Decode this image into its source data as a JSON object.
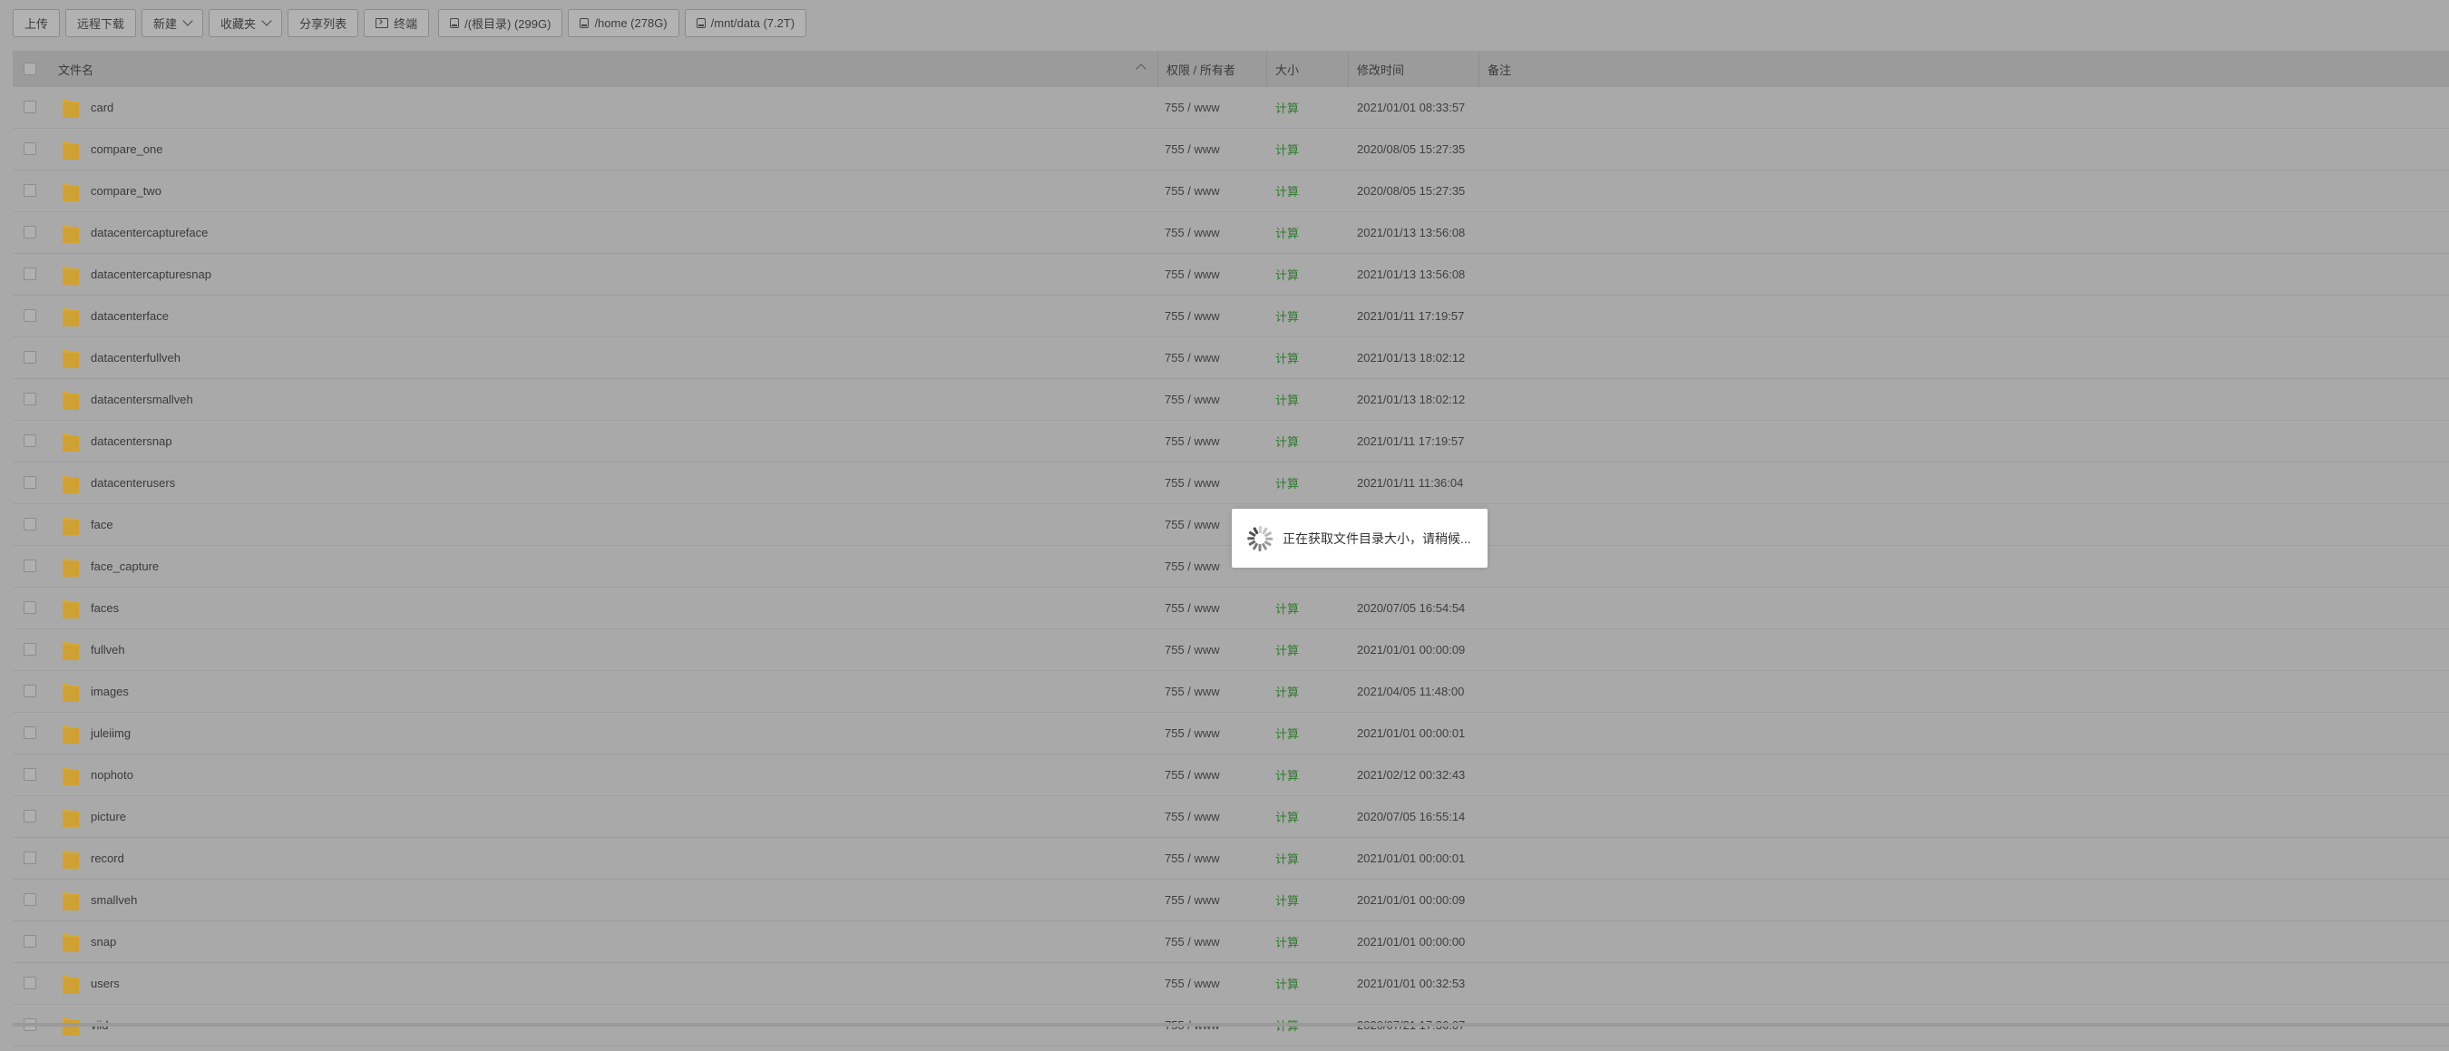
{
  "toolbar": {
    "upload": "上传",
    "remote_download": "远程下载",
    "new": "新建",
    "favorites": "收藏夹",
    "share_list": "分享列表",
    "terminal": "终端",
    "disks": [
      {
        "label": "/(根目录) (299G)",
        "icon": "disk-icon"
      },
      {
        "label": "/home (278G)",
        "icon": "disk-icon"
      },
      {
        "label": "/mnt/data (7.2T)",
        "icon": "disk-icon"
      }
    ]
  },
  "table": {
    "headers": {
      "name": "文件名",
      "perm": "权限 / 所有者",
      "size": "大小",
      "mtime": "修改时间",
      "note": "备注"
    },
    "rows": [
      {
        "name": "card",
        "perm": "755 / www",
        "size": "计算",
        "mtime": "2021/01/01 08:33:57"
      },
      {
        "name": "compare_one",
        "perm": "755 / www",
        "size": "计算",
        "mtime": "2020/08/05 15:27:35"
      },
      {
        "name": "compare_two",
        "perm": "755 / www",
        "size": "计算",
        "mtime": "2020/08/05 15:27:35"
      },
      {
        "name": "datacentercaptureface",
        "perm": "755 / www",
        "size": "计算",
        "mtime": "2021/01/13 13:56:08"
      },
      {
        "name": "datacentercapturesnap",
        "perm": "755 / www",
        "size": "计算",
        "mtime": "2021/01/13 13:56:08"
      },
      {
        "name": "datacenterface",
        "perm": "755 / www",
        "size": "计算",
        "mtime": "2021/01/11 17:19:57"
      },
      {
        "name": "datacenterfullveh",
        "perm": "755 / www",
        "size": "计算",
        "mtime": "2021/01/13 18:02:12"
      },
      {
        "name": "datacentersmallveh",
        "perm": "755 / www",
        "size": "计算",
        "mtime": "2021/01/13 18:02:12"
      },
      {
        "name": "datacentersnap",
        "perm": "755 / www",
        "size": "计算",
        "mtime": "2021/01/11 17:19:57"
      },
      {
        "name": "datacenterusers",
        "perm": "755 / www",
        "size": "计算",
        "mtime": "2021/01/11 11:36:04"
      },
      {
        "name": "face",
        "perm": "755 / www",
        "size": "",
        "mtime": ""
      },
      {
        "name": "face_capture",
        "perm": "755 / www",
        "size": "",
        "mtime": ""
      },
      {
        "name": "faces",
        "perm": "755 / www",
        "size": "计算",
        "mtime": "2020/07/05 16:54:54"
      },
      {
        "name": "fullveh",
        "perm": "755 / www",
        "size": "计算",
        "mtime": "2021/01/01 00:00:09"
      },
      {
        "name": "images",
        "perm": "755 / www",
        "size": "计算",
        "mtime": "2021/04/05 11:48:00"
      },
      {
        "name": "juleiimg",
        "perm": "755 / www",
        "size": "计算",
        "mtime": "2021/01/01 00:00:01"
      },
      {
        "name": "nophoto",
        "perm": "755 / www",
        "size": "计算",
        "mtime": "2021/02/12 00:32:43"
      },
      {
        "name": "picture",
        "perm": "755 / www",
        "size": "计算",
        "mtime": "2020/07/05 16:55:14"
      },
      {
        "name": "record",
        "perm": "755 / www",
        "size": "计算",
        "mtime": "2021/01/01 00:00:01"
      },
      {
        "name": "smallveh",
        "perm": "755 / www",
        "size": "计算",
        "mtime": "2021/01/01 00:00:09"
      },
      {
        "name": "snap",
        "perm": "755 / www",
        "size": "计算",
        "mtime": "2021/01/01 00:00:00"
      },
      {
        "name": "users",
        "perm": "755 / www",
        "size": "计算",
        "mtime": "2021/01/01 00:32:53"
      },
      {
        "name": "viid",
        "perm": "755 / www",
        "size": "计算",
        "mtime": "2020/07/21 17:36:07"
      }
    ]
  },
  "loading": {
    "text": "正在获取文件目录大小，请稍候..."
  },
  "colors": {
    "overlay_bg": "#a9a9a9",
    "folder": "#d4a83a",
    "size_link": "#2f7a2f"
  }
}
